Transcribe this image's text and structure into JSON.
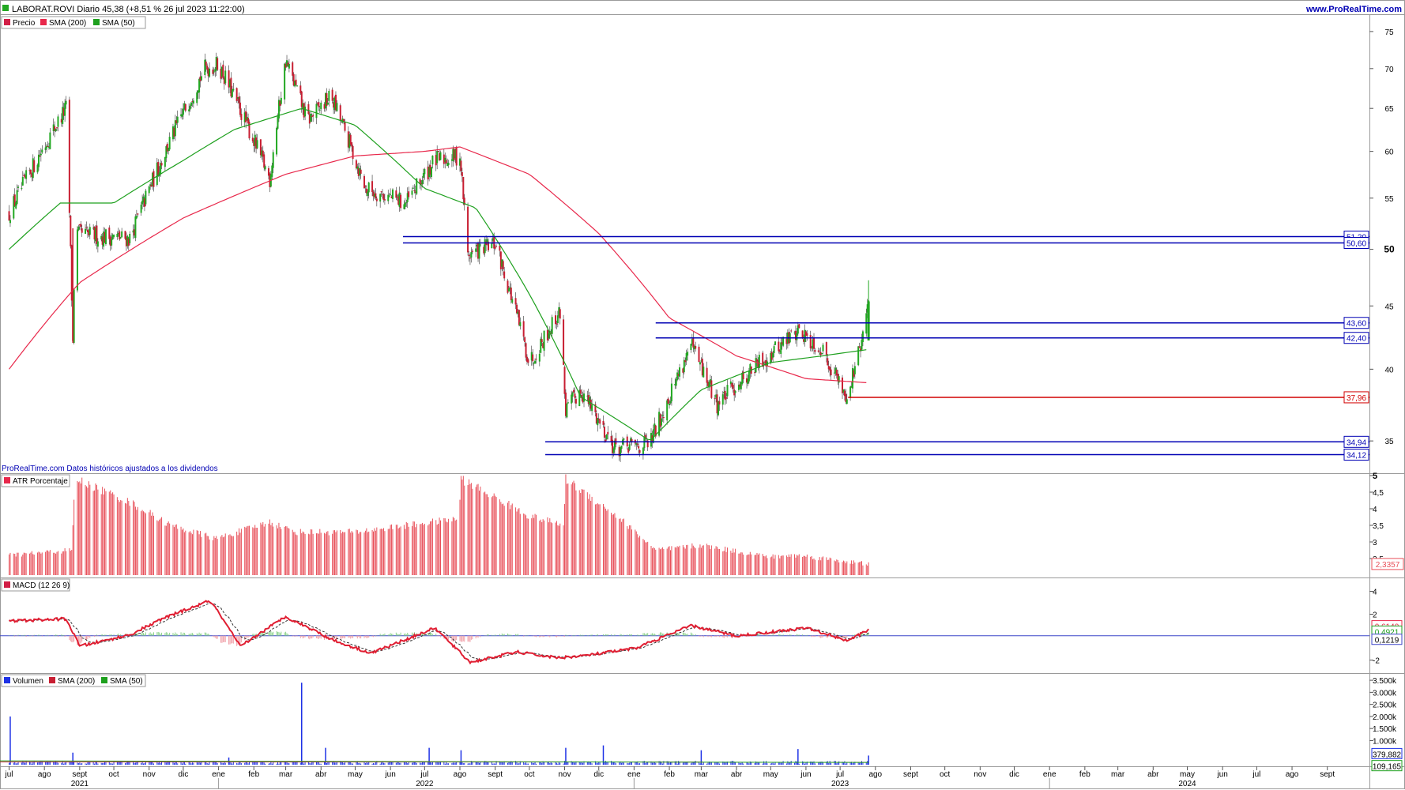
{
  "header": {
    "title": "LABORAT.ROVI Diario 45,38 (+8,51 % 26 jul 2023 11:22:00)",
    "site": "www.ProRealTime.com",
    "footer_note": "ProRealTime.com Datos históricos ajustados a los dividendos"
  },
  "colors": {
    "price": "#d21e46",
    "candle_up": "#22a822",
    "candle_down": "#c81e32",
    "sma200": "#e8284b",
    "sma50": "#1ea01e",
    "level_blue": "#0000b4",
    "level_red": "#d20000",
    "atr": "#e8505a",
    "volume": "#1e32e6"
  },
  "chart_data": [
    {
      "type": "line",
      "panel": "price",
      "legend": [
        "Precio",
        "SMA (200)",
        "SMA (50)"
      ],
      "ylim": [
        33.3,
        77
      ],
      "yscale": "log",
      "yticks": [
        "75",
        "70",
        "65",
        "60",
        "55",
        "50",
        "45",
        "40",
        "35"
      ],
      "bold_ytick": "50",
      "series": [
        {
          "name": "Precio",
          "x": [
            "2021-07-01",
            "2021-08-20",
            "2021-08-26",
            "2021-08-28",
            "2021-10-15",
            "2021-12-20",
            "2022-01-01",
            "2022-02-15",
            "2022-03-01",
            "2022-03-20",
            "2022-04-10",
            "2022-05-10",
            "2022-06-15",
            "2022-07-10",
            "2022-08-01",
            "2022-08-08",
            "2022-09-01",
            "2022-10-01",
            "2022-10-28",
            "2022-11-02",
            "2022-11-15",
            "2022-12-15",
            "2023-01-15",
            "2023-02-20",
            "2023-03-15",
            "2023-04-15",
            "2023-05-25",
            "2023-06-15",
            "2023-07-07",
            "2023-07-12",
            "2023-07-20",
            "2023-07-26"
          ],
          "close": [
            53.5,
            65.0,
            42.0,
            51.5,
            51.0,
            70.0,
            70.5,
            57.0,
            71.0,
            63.5,
            66.5,
            56.0,
            54.5,
            59.0,
            59.5,
            49.5,
            50.5,
            40.5,
            44.5,
            37.0,
            38.5,
            34.5,
            34.8,
            41.8,
            37.5,
            40.0,
            43.0,
            41.5,
            38.0,
            39.5,
            42.0,
            45.38
          ]
        },
        {
          "name": "SMA (200)",
          "x": [
            "2021-07-01",
            "2021-09-01",
            "2021-12-01",
            "2022-03-01",
            "2022-05-01",
            "2022-07-01",
            "2022-08-01",
            "2022-10-01",
            "2022-12-01",
            "2023-02-01",
            "2023-04-01",
            "2023-06-01",
            "2023-07-26"
          ],
          "values": [
            40.0,
            47.0,
            53.0,
            57.5,
            59.5,
            60.0,
            60.5,
            57.5,
            51.5,
            44.0,
            41.0,
            39.3,
            39.0
          ]
        },
        {
          "name": "SMA (50)",
          "x": [
            "2021-07-01",
            "2021-08-15",
            "2021-10-01",
            "2021-12-01",
            "2022-01-15",
            "2022-03-15",
            "2022-05-01",
            "2022-07-01",
            "2022-08-15",
            "2022-10-01",
            "2022-11-15",
            "2023-01-15",
            "2023-03-01",
            "2023-05-01",
            "2023-06-15",
            "2023-07-26"
          ],
          "values": [
            50.0,
            54.5,
            54.5,
            59.0,
            62.5,
            65.0,
            63.0,
            56.0,
            54.0,
            46.0,
            38.0,
            35.0,
            38.5,
            40.5,
            41.0,
            41.5
          ]
        }
      ],
      "levels": [
        {
          "label": "51,20",
          "value": 51.2,
          "from": "2022-06-12",
          "color": "blue"
        },
        {
          "label": "50,60",
          "value": 50.6,
          "from": "2022-06-12",
          "color": "blue"
        },
        {
          "label": "43,60",
          "value": 43.6,
          "from": "2023-01-20",
          "color": "blue"
        },
        {
          "label": "42,40",
          "value": 42.4,
          "from": "2023-01-20",
          "color": "blue"
        },
        {
          "label": "37,96",
          "value": 37.96,
          "from": "2023-07-08",
          "color": "red"
        },
        {
          "label": "34,94",
          "value": 34.94,
          "from": "2022-10-15",
          "color": "blue"
        },
        {
          "label": "34,12",
          "value": 34.12,
          "from": "2022-10-15",
          "color": "blue"
        }
      ]
    },
    {
      "type": "bar",
      "panel": "atr",
      "legend": [
        "ATR Porcentaje"
      ],
      "ylim": [
        2.0,
        5.0
      ],
      "yticks": [
        "5",
        "4,5",
        "4",
        "3,5",
        "3",
        "2,5"
      ],
      "last_value_label": "2,3357",
      "x": [
        "2021-07-01",
        "2021-08-25",
        "2021-08-28",
        "2021-10-15",
        "2021-11-20",
        "2021-12-30",
        "2022-02-15",
        "2022-03-10",
        "2022-05-01",
        "2022-07-31",
        "2022-08-02",
        "2022-09-30",
        "2022-10-31",
        "2022-11-02",
        "2022-12-20",
        "2023-01-20",
        "2023-03-01",
        "2023-05-01",
        "2023-05-25",
        "2023-07-26"
      ],
      "values": [
        2.6,
        2.75,
        4.9,
        4.2,
        3.5,
        3.1,
        3.6,
        3.3,
        3.3,
        3.7,
        4.9,
        3.8,
        3.5,
        4.9,
        3.7,
        2.75,
        2.9,
        2.55,
        2.6,
        2.33
      ]
    },
    {
      "type": "line",
      "panel": "macd",
      "legend": [
        "MACD (12 26 9)"
      ],
      "ylim": [
        -3.0,
        5.0
      ],
      "yticks": [
        "4",
        "2",
        "-2"
      ],
      "value_labels": [
        "0,6140",
        "0,4921",
        "0,1219"
      ],
      "series": [
        {
          "name": "MACD (12 26 9)",
          "x": [
            "2021-07-01",
            "2021-08-20",
            "2021-09-01",
            "2021-10-15",
            "2021-11-15",
            "2021-12-25",
            "2022-01-20",
            "2022-03-01",
            "2022-04-15",
            "2022-05-15",
            "2022-07-10",
            "2022-08-10",
            "2022-09-20",
            "2022-10-25",
            "2022-11-20",
            "2023-01-01",
            "2023-02-20",
            "2023-04-01",
            "2023-06-01",
            "2023-07-08",
            "2023-07-26"
          ],
          "values": [
            1.4,
            1.6,
            -0.8,
            0.2,
            1.7,
            3.2,
            -0.8,
            1.8,
            -0.4,
            -1.4,
            0.8,
            -2.2,
            -1.3,
            -1.8,
            -1.6,
            -1.0,
            1.0,
            0.1,
            0.8,
            -0.3,
            0.61
          ]
        }
      ]
    },
    {
      "type": "bar",
      "panel": "volume",
      "legend": [
        "Volumen",
        "SMA (200)",
        "SMA (50)"
      ],
      "ylim": [
        0,
        3700000
      ],
      "yticks": [
        "3.500k",
        "3.000k",
        "2.500k",
        "2.000k",
        "1.500k",
        "1.000k"
      ],
      "value_labels": [
        "379,882",
        "109,165"
      ],
      "spikes": [
        {
          "x": "2021-07-02",
          "value": 2000000
        },
        {
          "x": "2021-08-26",
          "value": 500000
        },
        {
          "x": "2022-01-10",
          "value": 300000
        },
        {
          "x": "2022-03-15",
          "value": 3400000
        },
        {
          "x": "2022-04-05",
          "value": 700000
        },
        {
          "x": "2022-07-05",
          "value": 700000
        },
        {
          "x": "2022-08-02",
          "value": 600000
        },
        {
          "x": "2022-11-02",
          "value": 700000
        },
        {
          "x": "2022-12-05",
          "value": 800000
        },
        {
          "x": "2023-03-01",
          "value": 600000
        },
        {
          "x": "2023-05-25",
          "value": 650000
        },
        {
          "x": "2023-07-26",
          "value": 380000
        }
      ]
    }
  ],
  "x_axis": {
    "range": [
      "2021-06-23",
      "2024-10-08"
    ],
    "months": [
      {
        "label": "jul",
        "x": "2021-07-01"
      },
      {
        "label": "ago",
        "x": "2021-08-01"
      },
      {
        "label": "sept",
        "x": "2021-09-01"
      },
      {
        "label": "oct",
        "x": "2021-10-01"
      },
      {
        "label": "nov",
        "x": "2021-11-01"
      },
      {
        "label": "dic",
        "x": "2021-12-01"
      },
      {
        "label": "ene",
        "x": "2022-01-01"
      },
      {
        "label": "feb",
        "x": "2022-02-01"
      },
      {
        "label": "mar",
        "x": "2022-03-01"
      },
      {
        "label": "abr",
        "x": "2022-04-01"
      },
      {
        "label": "may",
        "x": "2022-05-01"
      },
      {
        "label": "jun",
        "x": "2022-06-01"
      },
      {
        "label": "jul",
        "x": "2022-07-01"
      },
      {
        "label": "ago",
        "x": "2022-08-01"
      },
      {
        "label": "sept",
        "x": "2022-09-01"
      },
      {
        "label": "oct",
        "x": "2022-10-01"
      },
      {
        "label": "nov",
        "x": "2022-11-01"
      },
      {
        "label": "dic",
        "x": "2022-12-01"
      },
      {
        "label": "ene",
        "x": "2023-01-01"
      },
      {
        "label": "feb",
        "x": "2023-02-01"
      },
      {
        "label": "mar",
        "x": "2023-03-01"
      },
      {
        "label": "abr",
        "x": "2023-04-01"
      },
      {
        "label": "may",
        "x": "2023-05-01"
      },
      {
        "label": "jun",
        "x": "2023-06-01"
      },
      {
        "label": "jul",
        "x": "2023-07-01"
      },
      {
        "label": "ago",
        "x": "2023-08-01"
      },
      {
        "label": "sept",
        "x": "2023-09-01"
      },
      {
        "label": "oct",
        "x": "2023-10-01"
      },
      {
        "label": "nov",
        "x": "2023-11-01"
      },
      {
        "label": "dic",
        "x": "2023-12-01"
      },
      {
        "label": "ene",
        "x": "2024-01-01"
      },
      {
        "label": "feb",
        "x": "2024-02-01"
      },
      {
        "label": "mar",
        "x": "2024-03-01"
      },
      {
        "label": "abr",
        "x": "2024-04-01"
      },
      {
        "label": "may",
        "x": "2024-05-01"
      },
      {
        "label": "jun",
        "x": "2024-06-01"
      },
      {
        "label": "jul",
        "x": "2024-07-01"
      },
      {
        "label": "ago",
        "x": "2024-08-01"
      },
      {
        "label": "sept",
        "x": "2024-09-01"
      }
    ],
    "years": [
      {
        "label": "2021",
        "x": "2021-09-01"
      },
      {
        "label": "2022",
        "x": "2022-07-01"
      },
      {
        "label": "2023",
        "x": "2023-07-01"
      },
      {
        "label": "2024",
        "x": "2024-05-01"
      }
    ]
  }
}
